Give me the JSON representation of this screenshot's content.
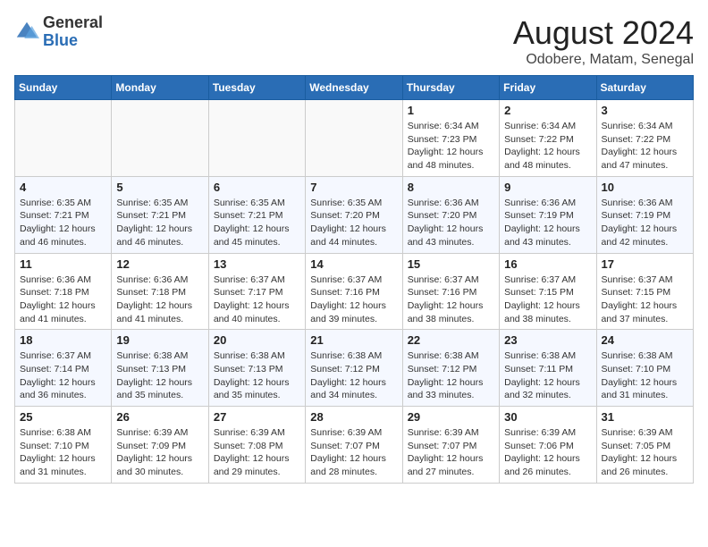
{
  "header": {
    "logo_general": "General",
    "logo_blue": "Blue",
    "month_title": "August 2024",
    "subtitle": "Odobere, Matam, Senegal"
  },
  "calendar": {
    "days_of_week": [
      "Sunday",
      "Monday",
      "Tuesday",
      "Wednesday",
      "Thursday",
      "Friday",
      "Saturday"
    ],
    "weeks": [
      [
        {
          "day": "",
          "info": ""
        },
        {
          "day": "",
          "info": ""
        },
        {
          "day": "",
          "info": ""
        },
        {
          "day": "",
          "info": ""
        },
        {
          "day": "1",
          "info": "Sunrise: 6:34 AM\nSunset: 7:23 PM\nDaylight: 12 hours\nand 48 minutes."
        },
        {
          "day": "2",
          "info": "Sunrise: 6:34 AM\nSunset: 7:22 PM\nDaylight: 12 hours\nand 48 minutes."
        },
        {
          "day": "3",
          "info": "Sunrise: 6:34 AM\nSunset: 7:22 PM\nDaylight: 12 hours\nand 47 minutes."
        }
      ],
      [
        {
          "day": "4",
          "info": "Sunrise: 6:35 AM\nSunset: 7:21 PM\nDaylight: 12 hours\nand 46 minutes."
        },
        {
          "day": "5",
          "info": "Sunrise: 6:35 AM\nSunset: 7:21 PM\nDaylight: 12 hours\nand 46 minutes."
        },
        {
          "day": "6",
          "info": "Sunrise: 6:35 AM\nSunset: 7:21 PM\nDaylight: 12 hours\nand 45 minutes."
        },
        {
          "day": "7",
          "info": "Sunrise: 6:35 AM\nSunset: 7:20 PM\nDaylight: 12 hours\nand 44 minutes."
        },
        {
          "day": "8",
          "info": "Sunrise: 6:36 AM\nSunset: 7:20 PM\nDaylight: 12 hours\nand 43 minutes."
        },
        {
          "day": "9",
          "info": "Sunrise: 6:36 AM\nSunset: 7:19 PM\nDaylight: 12 hours\nand 43 minutes."
        },
        {
          "day": "10",
          "info": "Sunrise: 6:36 AM\nSunset: 7:19 PM\nDaylight: 12 hours\nand 42 minutes."
        }
      ],
      [
        {
          "day": "11",
          "info": "Sunrise: 6:36 AM\nSunset: 7:18 PM\nDaylight: 12 hours\nand 41 minutes."
        },
        {
          "day": "12",
          "info": "Sunrise: 6:36 AM\nSunset: 7:18 PM\nDaylight: 12 hours\nand 41 minutes."
        },
        {
          "day": "13",
          "info": "Sunrise: 6:37 AM\nSunset: 7:17 PM\nDaylight: 12 hours\nand 40 minutes."
        },
        {
          "day": "14",
          "info": "Sunrise: 6:37 AM\nSunset: 7:16 PM\nDaylight: 12 hours\nand 39 minutes."
        },
        {
          "day": "15",
          "info": "Sunrise: 6:37 AM\nSunset: 7:16 PM\nDaylight: 12 hours\nand 38 minutes."
        },
        {
          "day": "16",
          "info": "Sunrise: 6:37 AM\nSunset: 7:15 PM\nDaylight: 12 hours\nand 38 minutes."
        },
        {
          "day": "17",
          "info": "Sunrise: 6:37 AM\nSunset: 7:15 PM\nDaylight: 12 hours\nand 37 minutes."
        }
      ],
      [
        {
          "day": "18",
          "info": "Sunrise: 6:37 AM\nSunset: 7:14 PM\nDaylight: 12 hours\nand 36 minutes."
        },
        {
          "day": "19",
          "info": "Sunrise: 6:38 AM\nSunset: 7:13 PM\nDaylight: 12 hours\nand 35 minutes."
        },
        {
          "day": "20",
          "info": "Sunrise: 6:38 AM\nSunset: 7:13 PM\nDaylight: 12 hours\nand 35 minutes."
        },
        {
          "day": "21",
          "info": "Sunrise: 6:38 AM\nSunset: 7:12 PM\nDaylight: 12 hours\nand 34 minutes."
        },
        {
          "day": "22",
          "info": "Sunrise: 6:38 AM\nSunset: 7:12 PM\nDaylight: 12 hours\nand 33 minutes."
        },
        {
          "day": "23",
          "info": "Sunrise: 6:38 AM\nSunset: 7:11 PM\nDaylight: 12 hours\nand 32 minutes."
        },
        {
          "day": "24",
          "info": "Sunrise: 6:38 AM\nSunset: 7:10 PM\nDaylight: 12 hours\nand 31 minutes."
        }
      ],
      [
        {
          "day": "25",
          "info": "Sunrise: 6:38 AM\nSunset: 7:10 PM\nDaylight: 12 hours\nand 31 minutes."
        },
        {
          "day": "26",
          "info": "Sunrise: 6:39 AM\nSunset: 7:09 PM\nDaylight: 12 hours\nand 30 minutes."
        },
        {
          "day": "27",
          "info": "Sunrise: 6:39 AM\nSunset: 7:08 PM\nDaylight: 12 hours\nand 29 minutes."
        },
        {
          "day": "28",
          "info": "Sunrise: 6:39 AM\nSunset: 7:07 PM\nDaylight: 12 hours\nand 28 minutes."
        },
        {
          "day": "29",
          "info": "Sunrise: 6:39 AM\nSunset: 7:07 PM\nDaylight: 12 hours\nand 27 minutes."
        },
        {
          "day": "30",
          "info": "Sunrise: 6:39 AM\nSunset: 7:06 PM\nDaylight: 12 hours\nand 26 minutes."
        },
        {
          "day": "31",
          "info": "Sunrise: 6:39 AM\nSunset: 7:05 PM\nDaylight: 12 hours\nand 26 minutes."
        }
      ]
    ]
  }
}
